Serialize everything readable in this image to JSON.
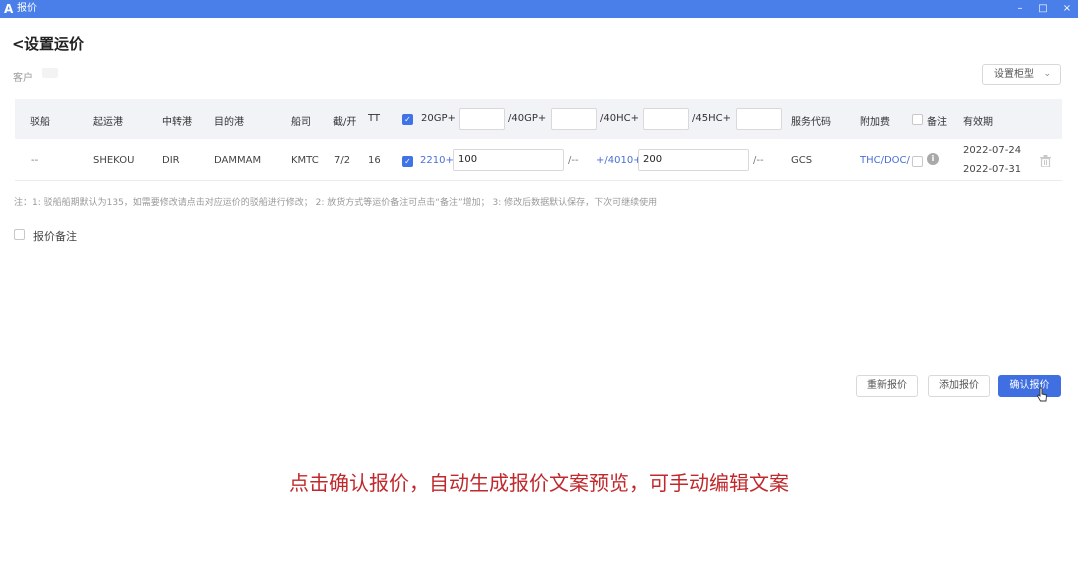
{
  "window": {
    "logo": "A",
    "title": "报价",
    "minimize": "–",
    "maximize": "□",
    "close": "×"
  },
  "page": {
    "back": "<",
    "title": "设置运价"
  },
  "customer": {
    "label": "客户"
  },
  "box_type": {
    "label": "设置柜型",
    "chevron": "⌄"
  },
  "table": {
    "headers": {
      "barge": "驳船",
      "origin": "起运港",
      "transit": "中转港",
      "destination": "目的港",
      "carrier": "船司",
      "cutoff": "截/开",
      "tt": "TT",
      "gp20": "20GP+",
      "gp40": "/40GP+",
      "hc40": "/40HC+",
      "hc45": "/45HC+",
      "service_code": "服务代码",
      "surcharge": "附加费",
      "remark": "备注",
      "validity": "有效期"
    },
    "row": {
      "barge": "--",
      "origin": "SHEKOU",
      "transit": "DIR",
      "destination": "DAMMAM",
      "carrier": "KMTC",
      "cutoff": "7/2",
      "tt": "16",
      "gp20_base": "2210+",
      "gp20_add": "100",
      "sep1": "/--",
      "gp40_base": "+/4010+",
      "gp40_add": "200",
      "sep2": "/--",
      "service_code": "GCS",
      "surcharge": "THC/DOC/",
      "valid_from": "2022-07-24",
      "valid_to": "2022-07-31"
    }
  },
  "note": "注：1: 驳船船期默认为135，如需要修改请点击对应运价的驳船进行修改；  2: 放货方式等运价备注可点击“备注”增加；  3: 修改后数据默认保存，下次可继续使用",
  "quote_remark": {
    "label": "报价备注"
  },
  "buttons": {
    "requote": "重新报价",
    "add_quote": "添加报价",
    "confirm_quote": "确认报价"
  },
  "caption": "点击确认报价，自动生成报价文案预览，可手动编辑文案",
  "icons": {
    "checkbox_checked": "✓",
    "info": "i"
  },
  "colors": {
    "titlebar": "#4a7ee8",
    "primary": "#3f6fe0",
    "caption": "#c0282c",
    "link": "#4a6fd6"
  }
}
